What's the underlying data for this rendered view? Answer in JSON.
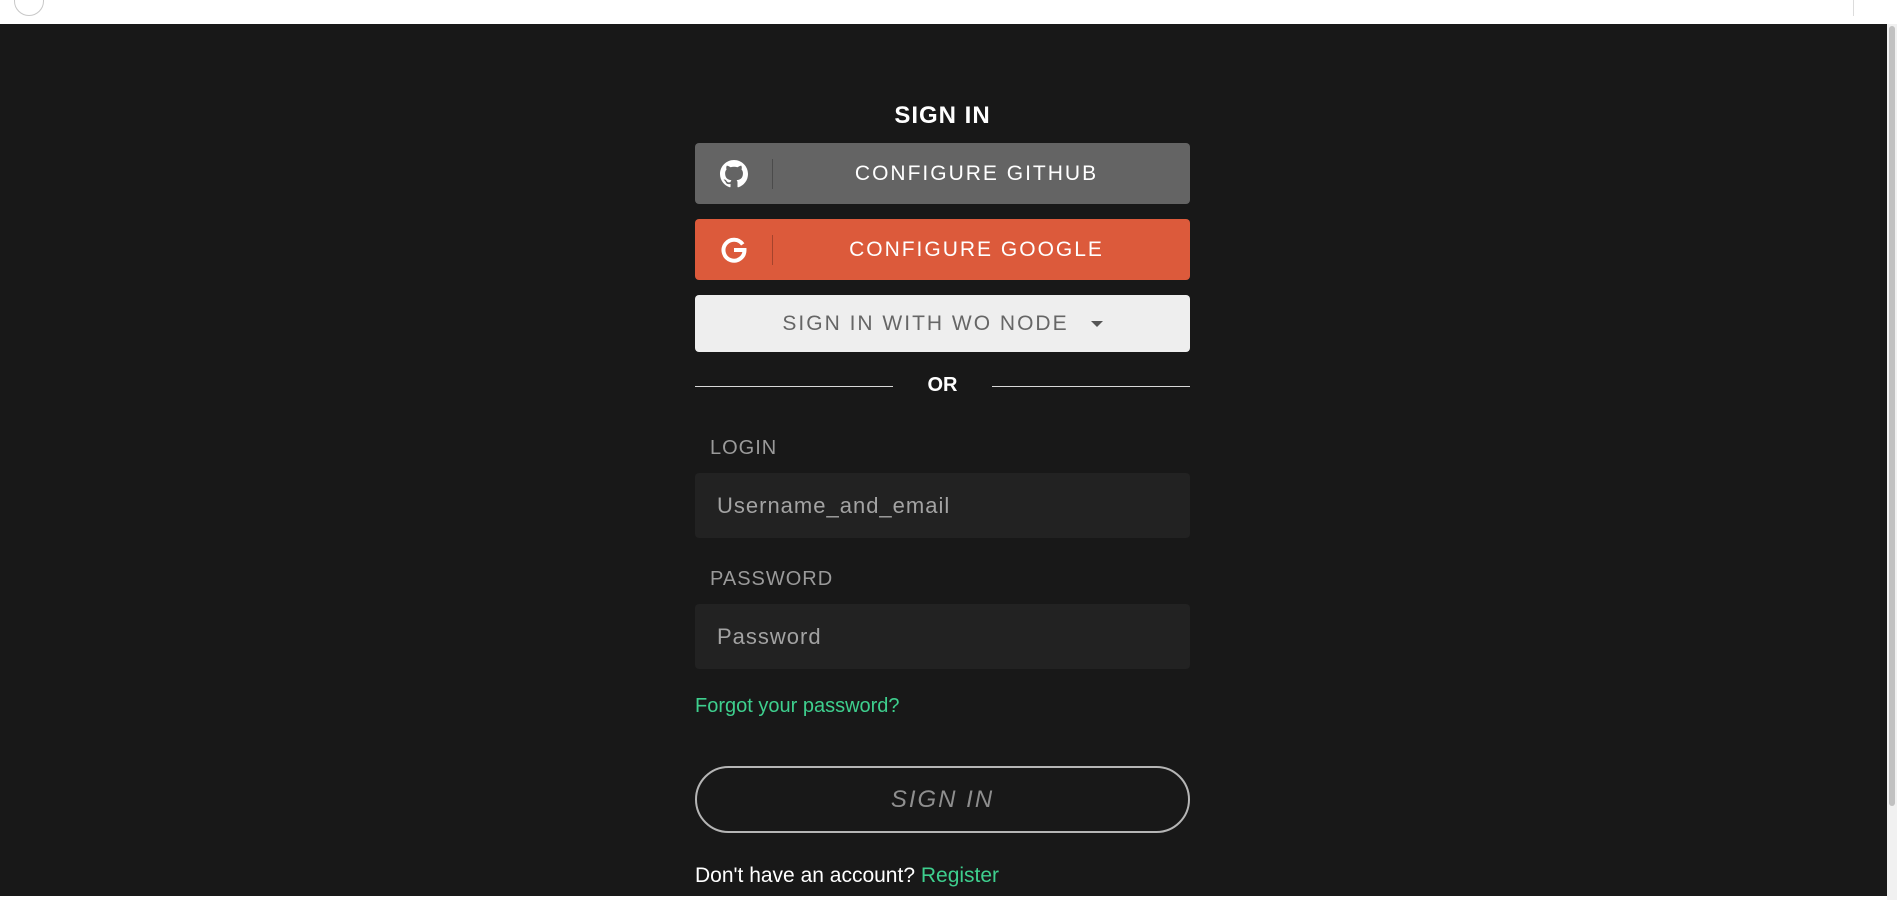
{
  "page": {
    "title": "SIGN IN"
  },
  "oauth": {
    "github_label": "CONFIGURE GITHUB",
    "google_label": "CONFIGURE GOOGLE",
    "node_label": "SIGN IN WITH WO NODE",
    "github_icon": "github-icon",
    "google_icon": "google-icon",
    "node_icon": "caret-down-icon"
  },
  "divider": {
    "label": "OR"
  },
  "form": {
    "login_label": "LOGIN",
    "login_placeholder": "Username_and_email",
    "password_label": "PASSWORD",
    "password_placeholder": "Password",
    "forgot_link": "Forgot your password?",
    "submit_label": "SIGN IN"
  },
  "footer": {
    "prompt": "Don't have an account? ",
    "register_link": "Register"
  },
  "colors": {
    "background": "#181818",
    "github_button": "#646464",
    "google_button": "#dc5a3b",
    "node_button": "#eeeeee",
    "link_accent": "#3ecf8e",
    "input_bg": "#222222"
  }
}
